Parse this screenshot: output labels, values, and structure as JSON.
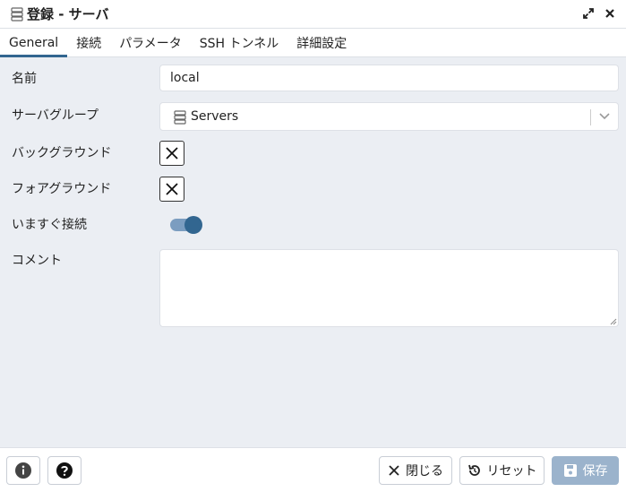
{
  "titlebar": {
    "icon": "server-icon",
    "title": "登録 - サーバ"
  },
  "tabs": [
    {
      "label": "General",
      "active": true
    },
    {
      "label": "接続",
      "active": false
    },
    {
      "label": "パラメータ",
      "active": false
    },
    {
      "label": "SSH トンネル",
      "active": false
    },
    {
      "label": "詳細設定",
      "active": false
    }
  ],
  "form": {
    "name_label": "名前",
    "name_value": "local",
    "group_label": "サーバグループ",
    "group_value": "Servers",
    "bg_label": "バックグラウンド",
    "fg_label": "フォアグラウンド",
    "connect_label": "いますぐ接続",
    "connect_on": true,
    "comment_label": "コメント",
    "comment_value": ""
  },
  "footer": {
    "close_label": "閉じる",
    "reset_label": "リセット",
    "save_label": "保存"
  },
  "colors": {
    "accent": "#326690",
    "save_disabled": "#9bb3cc",
    "panel_bg": "#ebeef3"
  }
}
